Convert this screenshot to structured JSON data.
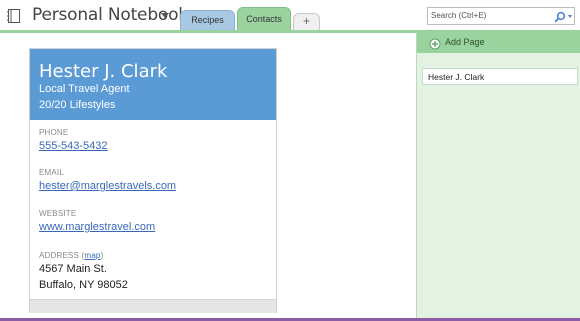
{
  "notebook": {
    "title": "Personal Notebook"
  },
  "tabs": [
    {
      "label": "Recipes"
    },
    {
      "label": "Contacts"
    },
    {
      "label": "+"
    }
  ],
  "search": {
    "placeholder": "Search (Ctrl+E)"
  },
  "colors": {
    "section_green": "#9bd39f",
    "card_header_blue": "#5b9bd5",
    "link_blue": "#3869b9",
    "bottom_line_purple": "#8c5ca3",
    "pane_background": "#e3f2e3"
  },
  "contact": {
    "name": "Hester J. Clark",
    "role": "Local Travel Agent",
    "company": "20/20 Lifestyles",
    "phone_label": "PHONE",
    "phone": "555-543-5432",
    "email_label": "EMAIL",
    "email": "hester@marglestravels.com",
    "website_label": "WEBSITE",
    "website": "www.marglestravel.com",
    "address_label": "ADDRESS",
    "map_prefix": "(",
    "map_link": "map",
    "map_suffix": ")",
    "address_line1": "4567 Main St.",
    "address_line2": "Buffalo, NY 98052"
  },
  "pages_pane": {
    "add_page_label": "Add Page",
    "pages": [
      {
        "label": "Hester J. Clark"
      }
    ]
  },
  "icons": {
    "notebook": "notebook-icon",
    "dropdown": "chevron-down-icon",
    "search": "search-icon",
    "add_page": "plus-circle-icon"
  }
}
